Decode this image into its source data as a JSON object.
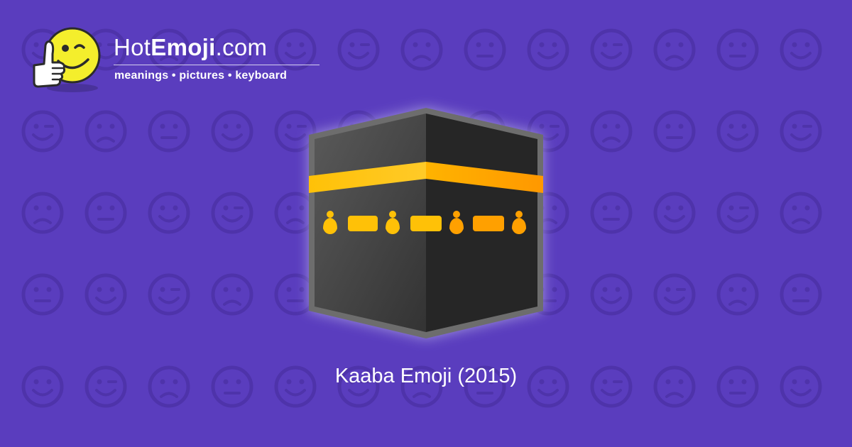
{
  "page": {
    "background_color": "#5a3dbe",
    "pattern_color": "#4e33aa"
  },
  "logo": {
    "mascot_icon": "winking-thumbs-up-smiley-icon",
    "brand_light": "Hot",
    "brand_bold": "Emoji",
    "brand_suffix": ".com",
    "tagline": "meanings • pictures • keyboard"
  },
  "emoji": {
    "icon": "kaaba-icon",
    "colors": {
      "stone_left": "#4a4a4a",
      "stone_right": "#262626",
      "band_gold": "#ffc107",
      "band_dark_gold": "#ff9800",
      "glow": "#9a8fd6"
    }
  },
  "caption": "Kaaba Emoji (2015)"
}
